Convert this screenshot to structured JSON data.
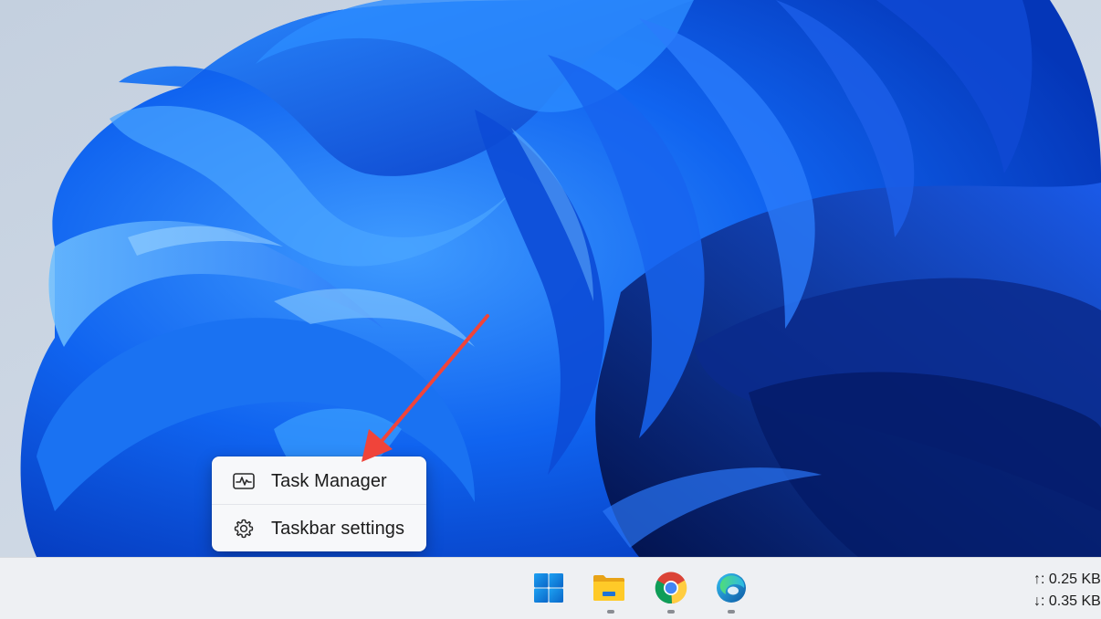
{
  "context_menu": {
    "items": [
      {
        "label": "Task Manager",
        "icon": "task-manager-icon"
      },
      {
        "label": "Taskbar settings",
        "icon": "gear-icon"
      }
    ]
  },
  "taskbar": {
    "apps": [
      {
        "name": "Start",
        "icon": "windows-start-icon"
      },
      {
        "name": "File Explorer",
        "icon": "file-explorer-icon"
      },
      {
        "name": "Google Chrome",
        "icon": "chrome-icon"
      },
      {
        "name": "Microsoft Edge",
        "icon": "edge-icon"
      }
    ],
    "network": {
      "upload": "↑: 0.25 KB",
      "download": "↓: 0.35 KB"
    }
  },
  "colors": {
    "annotation_arrow": "#f0443a",
    "menu_background": "#f7f8fa",
    "taskbar_background": "#eef0f3",
    "windows_blue": "#0f78d4"
  }
}
